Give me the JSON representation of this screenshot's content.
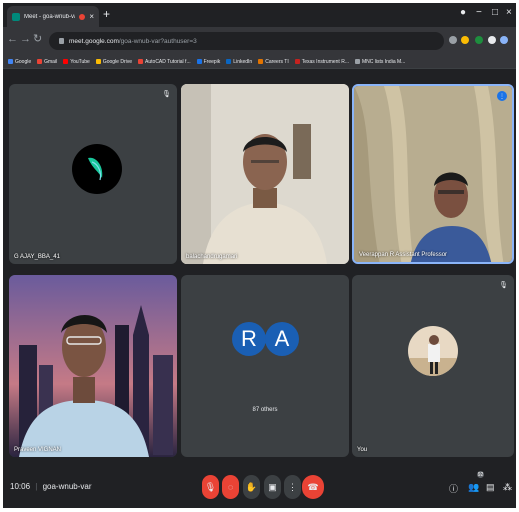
{
  "tab": {
    "title": "Meet - goa-wnub-var",
    "close": "×",
    "new_tab": "+"
  },
  "window": {
    "minimize": "−",
    "maximize": "□",
    "close": "×",
    "profile": "●"
  },
  "toolbar": {
    "back": "←",
    "forward": "→",
    "reload": "↻",
    "url_host": "meet.google.com",
    "url_path": "/goa-wnub-var?authuser=3"
  },
  "bookmarks": [
    {
      "label": "Google",
      "color": "#4285f4"
    },
    {
      "label": "Gmail",
      "color": "#ea4335"
    },
    {
      "label": "YouTube",
      "color": "#ff0000"
    },
    {
      "label": "Google Drive",
      "color": "#fbbc04"
    },
    {
      "label": "AutoCAD Tutorial f...",
      "color": "#ea4335"
    },
    {
      "label": "Freepik",
      "color": "#1a73e8"
    },
    {
      "label": "LinkedIn",
      "color": "#0a66c2"
    },
    {
      "label": "Careers TI",
      "color": "#e37400"
    },
    {
      "label": "Texas Instrument R...",
      "color": "#c5221f"
    },
    {
      "label": "MNC lists India M...",
      "color": "#9aa0a6"
    }
  ],
  "tiles": {
    "ajay": {
      "name": "G AJAY_BBA_41"
    },
    "host": {
      "name": "balachandrugamari"
    },
    "prof": {
      "name": "Veerappan R Assistant Professor"
    },
    "student": {
      "name": "Praveen VIGNAN"
    },
    "others": {
      "initial_a": "R",
      "initial_b": "A",
      "count_label": "87 others"
    },
    "you": {
      "name": "You"
    }
  },
  "bottom": {
    "time": "10:06",
    "separator": "|",
    "meeting_code": "goa-wnub-var",
    "people_count": "92"
  },
  "colors": {
    "background": "#202124",
    "tile": "#3c4043",
    "danger": "#ea4335",
    "avatar_blue": "#1a5fb4"
  }
}
